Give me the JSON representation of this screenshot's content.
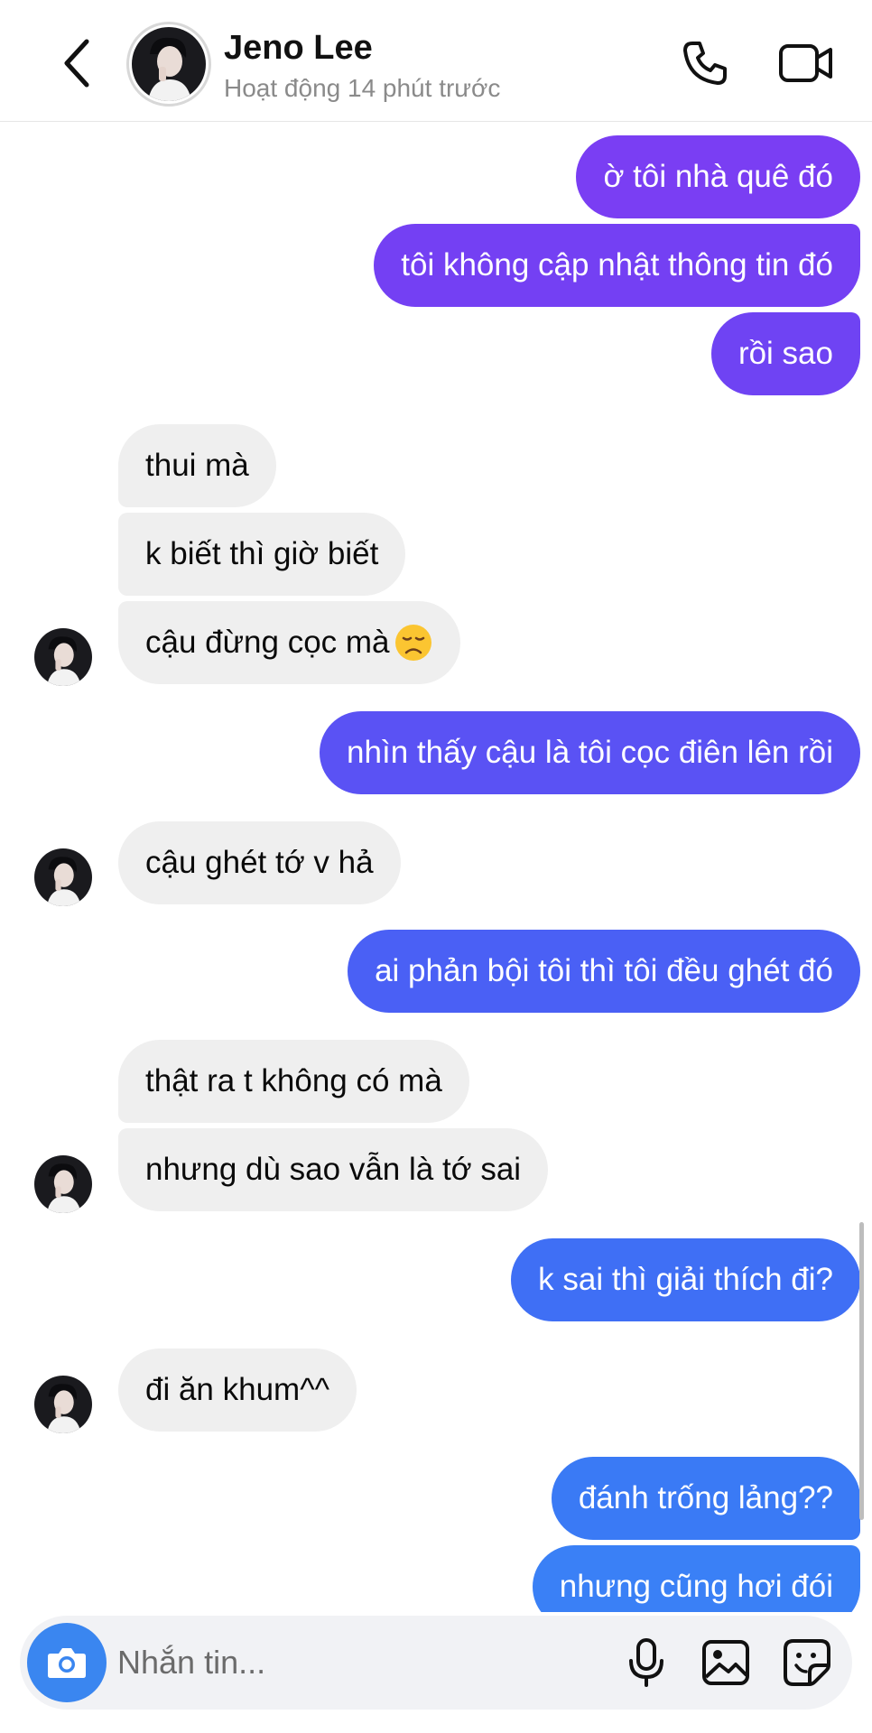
{
  "header": {
    "name": "Jeno Lee",
    "status": "Hoạt động 14 phút trước"
  },
  "messages": [
    {
      "side": "out",
      "text": "ờ tôi nhà quê đó"
    },
    {
      "side": "out",
      "text": "tôi không cập nhật thông tin đó"
    },
    {
      "side": "out",
      "text": "rồi sao"
    },
    {
      "side": "in",
      "text": "thui mà"
    },
    {
      "side": "in",
      "text": "k biết thì giờ biết"
    },
    {
      "side": "in",
      "text": "cậu đừng cọc mà",
      "emoji": "disappointed-face"
    },
    {
      "side": "out",
      "text": "nhìn thấy cậu là tôi cọc điên lên rồi"
    },
    {
      "side": "in",
      "text": "cậu ghét tớ v hả"
    },
    {
      "side": "out",
      "text": "ai phản bội tôi thì tôi đều ghét đó"
    },
    {
      "side": "in",
      "text": "thật ra t không có mà"
    },
    {
      "side": "in",
      "text": "nhưng dù sao vẫn là tớ sai"
    },
    {
      "side": "out",
      "text": "k sai thì giải thích đi?"
    },
    {
      "side": "in",
      "text": "đi ăn khum^^"
    },
    {
      "side": "out",
      "text": "đánh trống lảng??"
    },
    {
      "side": "out",
      "text": "nhưng cũng hơi đói"
    }
  ],
  "composer": {
    "placeholder": "Nhắn tin..."
  },
  "colors": {
    "outgoing_gradient_top": "#7b3ff2",
    "outgoing_gradient_bottom": "#3b82f6",
    "incoming_bg": "#efefef",
    "camera_button": "#3a86f0"
  },
  "icons": [
    "back-chevron-icon",
    "phone-icon",
    "video-camera-icon",
    "camera-icon",
    "microphone-icon",
    "image-icon",
    "sticker-icon"
  ]
}
